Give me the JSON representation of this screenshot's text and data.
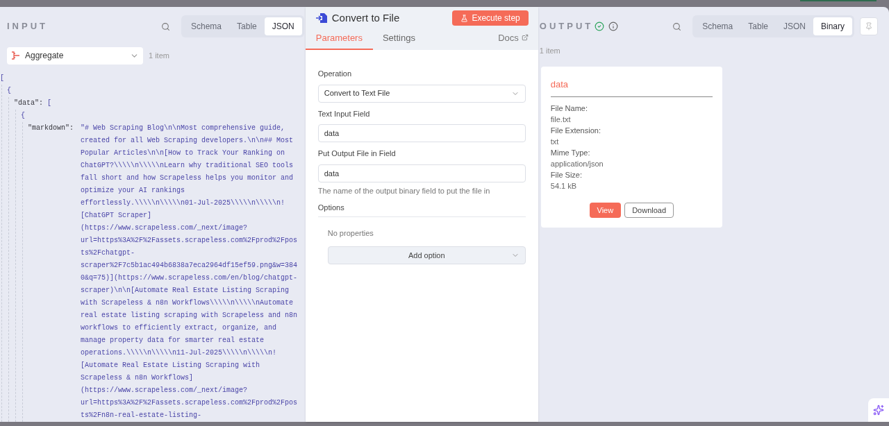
{
  "input": {
    "title": "INPUT",
    "tabs": [
      {
        "label": "Schema",
        "selected": false
      },
      {
        "label": "Table",
        "selected": false
      },
      {
        "label": "JSON",
        "selected": true
      }
    ],
    "node_select": {
      "value": "Aggregate"
    },
    "item_count": "1 item",
    "json": {
      "open": "[",
      "children": [
        {
          "open": "{",
          "children": [
            {
              "key": "\"data\":",
              "open": "[",
              "children": [
                {
                  "open": "{",
                  "children": [
                    {
                      "key": "\"markdown\":",
                      "lines": [
                        "\"# Web Scraping Blog\\n\\nMost comprehensive guide,",
                        "created for all Web Scraping developers.\\n\\n## Most",
                        "Popular Articles\\n\\n[How to Track Your Ranking on",
                        "ChatGPT?\\\\\\\\\\n\\\\\\\\\\nLearn why traditional SEO tools",
                        "fall short and how Scrapeless helps you monitor and",
                        "optimize your AI rankings",
                        "effortlessly.\\\\\\\\\\n\\\\\\\\\\n01-Jul-2025\\\\\\\\\\n\\\\\\\\\\n!",
                        "[ChatGPT Scraper]",
                        "(https://www.scrapeless.com/_next/image?",
                        "url=https%3A%2F%2Fassets.scrapeless.com%2Fprod%2Fpos",
                        "ts%2Fchatgpt-",
                        "scraper%2F7c5b1ac494b6838a7eca2964df15ef59.png&w=384",
                        "0&q=75)](https://www.scrapeless.com/en/blog/chatgpt-",
                        "scraper)\\n\\n[Automate Real Estate Listing Scraping",
                        "with Scrapeless & n8n Workflows\\\\\\\\\\n\\\\\\\\\\nAutomate",
                        "real estate listing scraping with Scrapeless and n8n",
                        "workflows to efficiently extract, organize, and",
                        "manage property data for smarter real estate",
                        "operations.\\\\\\\\\\n\\\\\\\\\\n11-Jul-2025\\\\\\\\\\n\\\\\\\\\\n!",
                        "[Automate Real Estate Listing Scraping with",
                        "Scrapeless & n8n Workflows]",
                        "(https://www.scrapeless.com/_next/image?",
                        "url=https%3A%2F%2Fassets.scrapeless.com%2Fprod%2Fpos",
                        "ts%2Fn8n-real-estate-listing-"
                      ]
                    }
                  ]
                }
              ]
            }
          ]
        }
      ]
    }
  },
  "node": {
    "title": "Convert to File",
    "execute_button": "Execute step",
    "tabs": [
      {
        "label": "Parameters",
        "selected": true
      },
      {
        "label": "Settings",
        "selected": false
      }
    ],
    "docs_link": "Docs",
    "fields": [
      {
        "kind": "select",
        "label": "Operation",
        "value": "Convert to Text File"
      },
      {
        "kind": "text",
        "label": "Text Input Field",
        "value": "data"
      },
      {
        "kind": "text",
        "label": "Put Output File in Field",
        "value": "data",
        "hint": "The name of the output binary field to put the file in"
      }
    ],
    "options": {
      "label": "Options",
      "empty_text": "No properties",
      "add_button": "Add option"
    }
  },
  "output": {
    "title": "OUTPUT",
    "tabs": [
      {
        "label": "Schema",
        "selected": false
      },
      {
        "label": "Table",
        "selected": false
      },
      {
        "label": "JSON",
        "selected": false
      },
      {
        "label": "Binary",
        "selected": true
      }
    ],
    "item_count": "1 item",
    "binary": {
      "name": "data",
      "properties": [
        {
          "label": "File Name:",
          "value": "file.txt"
        },
        {
          "label": "File Extension:",
          "value": "txt"
        },
        {
          "label": "Mime Type:",
          "value": "application/json"
        },
        {
          "label": "File Size:",
          "value": "54.1 kB"
        }
      ],
      "view_button": "View",
      "download_button": "Download"
    }
  }
}
